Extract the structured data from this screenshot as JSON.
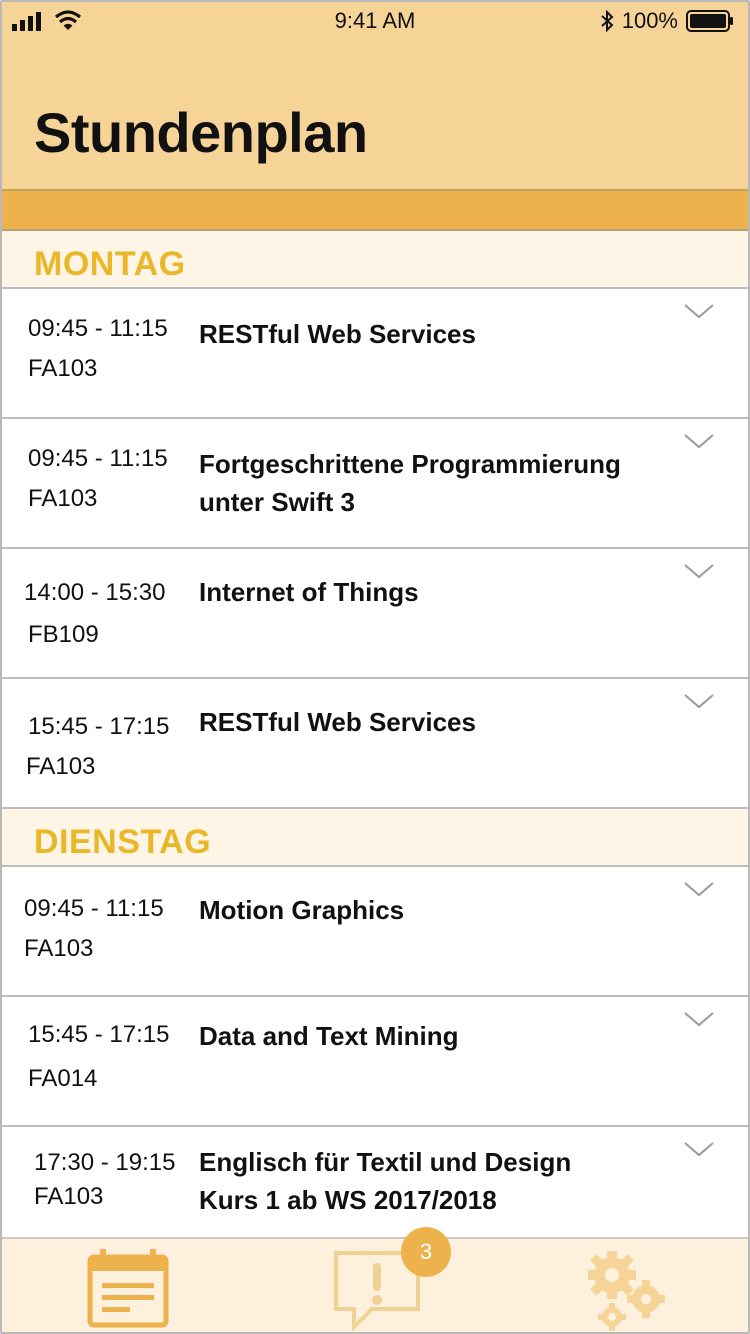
{
  "status_bar": {
    "time": "9:41 AM",
    "battery": "100%"
  },
  "header": {
    "title": "Stundenplan"
  },
  "sections": [
    {
      "day": "MONTAG",
      "rows": [
        {
          "time": "09:45 - 11:15",
          "room": "FA103",
          "course": "RESTful Web Services"
        },
        {
          "time": "09:45 - 11:15",
          "room": "FA103",
          "course": "Fortgeschrittene Programmierung unter Swift 3"
        },
        {
          "time": "14:00 - 15:30",
          "room": "FB109",
          "course": "Internet of Things"
        },
        {
          "time": "15:45 - 17:15",
          "room": "FA103",
          "course": "RESTful Web Services"
        }
      ]
    },
    {
      "day": "DIENSTAG",
      "rows": [
        {
          "time": "09:45 - 11:15",
          "room": "FA103",
          "course": "Motion Graphics"
        },
        {
          "time": "15:45 - 17:15",
          "room": "FA014",
          "course": "Data and Text Mining"
        },
        {
          "time": "17:30 - 19:15",
          "room": "FA103",
          "course": "Englisch für Textil und Design Kurs 1 ab WS 2017/2018"
        }
      ]
    }
  ],
  "tabbar": {
    "tabs": [
      {
        "icon": "calendar-icon"
      },
      {
        "icon": "alert-message-icon",
        "badge": "3"
      },
      {
        "icon": "gears-icon"
      }
    ]
  },
  "colors": {
    "header_bg": "#f6d498",
    "accent": "#edb24b",
    "section_text": "#e9b728",
    "section_bg": "#fff5e6",
    "tabbar_bg": "#fdf1de"
  }
}
